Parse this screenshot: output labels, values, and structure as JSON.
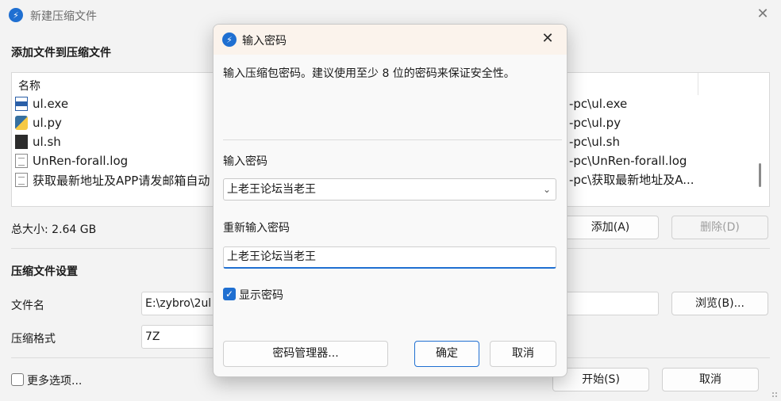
{
  "main": {
    "title": "新建压缩文件",
    "close_glyph": "✕",
    "add_section_title": "添加文件到压缩文件",
    "file_list": {
      "name_header": "名称",
      "rows": [
        {
          "name": "ul.exe",
          "icon": "exe-file-icon",
          "path": "-pc\\ul.exe"
        },
        {
          "name": "ul.py",
          "icon": "python-file-icon",
          "path": "-pc\\ul.py"
        },
        {
          "name": "ul.sh",
          "icon": "shell-file-icon",
          "path": "-pc\\ul.sh"
        },
        {
          "name": "UnRen-forall.log",
          "icon": "log-file-icon",
          "path": "-pc\\UnRen-forall.log"
        },
        {
          "name": "获取最新地址及APP请发邮箱自动",
          "icon": "text-file-icon",
          "path": "-pc\\获取最新地址及A..."
        }
      ]
    },
    "total_size": "总大小: 2.64 GB",
    "add_button": "添加(A)",
    "delete_button": "删除(D)",
    "settings_title": "压缩文件设置",
    "filename_label": "文件名",
    "filename_value": "E:\\zybro\\2ul",
    "browse_button": "浏览(B)...",
    "format_label": "压缩格式",
    "format_value": "7Z",
    "more_options": "更多选项...",
    "start_button": "开始(S)",
    "cancel_button": "取消"
  },
  "dialog": {
    "title": "输入密码",
    "close_glyph": "✕",
    "message": "输入压缩包密码。建议使用至少 8 位的密码来保证安全性。",
    "password_label": "输入密码",
    "password_value": "上老王论坛当老王",
    "reenter_label": "重新输入密码",
    "reenter_value": "上老王论坛当老王",
    "show_password_label": "显示密码",
    "show_password_checked": true,
    "manager_button": "密码管理器...",
    "ok_button": "确定",
    "cancel_button": "取消"
  },
  "colors": {
    "accent": "#1f6fd1",
    "dialog_title_bg": "#fbf3ec",
    "window_bg": "#f3f3f3"
  }
}
